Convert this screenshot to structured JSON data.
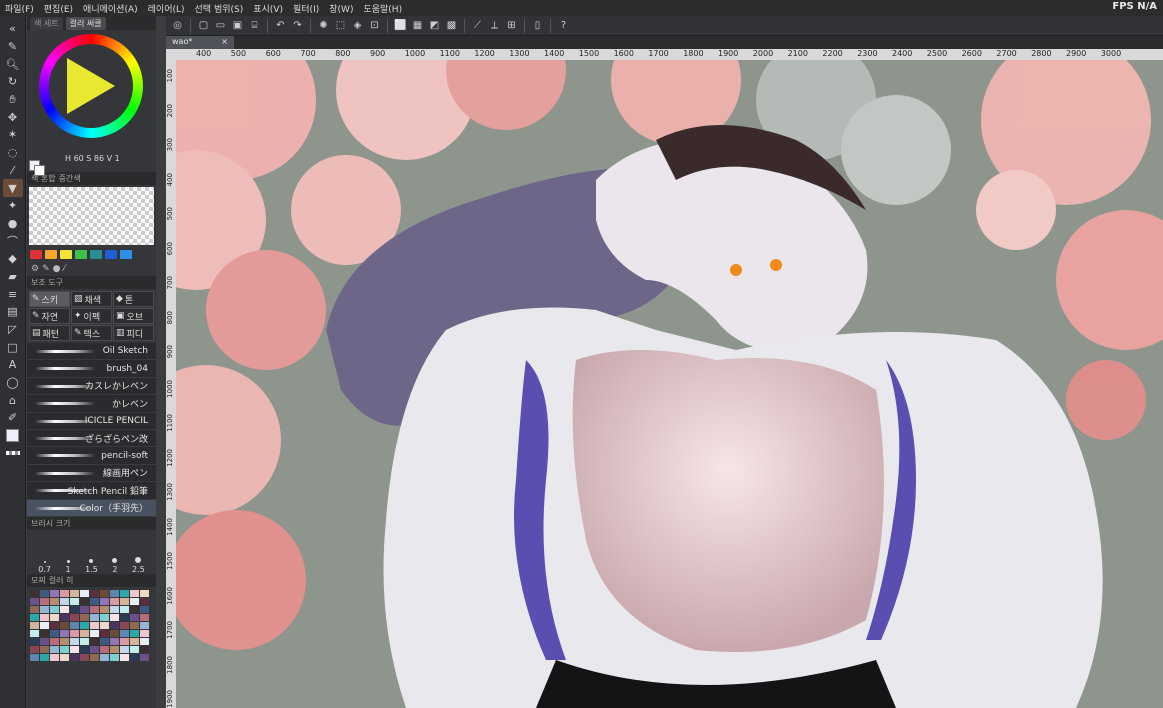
{
  "menu": [
    "파일(F)",
    "편집(E)",
    "애니메이션(A)",
    "레이어(L)",
    "선택 범위(S)",
    "표시(V)",
    "필터(I)",
    "창(W)",
    "도움말(H)"
  ],
  "fps": {
    "label": "FPS",
    "value": "N/A"
  },
  "color_panel": {
    "tab_inactive": "색 세트",
    "tab_active": "컬러 써클",
    "h": "60",
    "s": "86",
    "v": "1"
  },
  "color_mix": {
    "tab1": "색 혼합",
    "tab2": "중간색"
  },
  "swatch_colors": [
    "#e2313a",
    "#f5a52a",
    "#f0e534",
    "#3ec24b",
    "#2a8f92",
    "#1f5fd6",
    "#2e8fe8"
  ],
  "subtool": {
    "header": "보조 도구",
    "items": [
      "스키",
      "채색",
      "톤",
      "자연",
      "이펙",
      "오브",
      "패턴",
      "텍스",
      "피디"
    ]
  },
  "brushes": [
    "Oil Sketch",
    "brush_04",
    "カスレかレベン",
    "かレベン",
    "ICICLE PENCIL",
    "ざらざらペン改",
    "pencil-soft",
    "線画用ペン",
    "Sketch Pencil 鉛筆",
    "Color（手羽先）"
  ],
  "brush_size": {
    "header": "브러시 크기",
    "values": [
      "0.7",
      "1",
      "1.5",
      "2",
      "2.5"
    ]
  },
  "palette_tabs": {
    "tab1": "모찌",
    "tab2": "컬러 히"
  },
  "document": {
    "tab": "wao*"
  },
  "ruler_h": [
    "400",
    "500",
    "600",
    "700",
    "800",
    "900",
    "1000",
    "1100",
    "1200",
    "1300",
    "1400",
    "1500",
    "1600",
    "1700",
    "1800",
    "1900",
    "2000",
    "2100",
    "2200",
    "2300",
    "2400",
    "2500",
    "2600",
    "2700",
    "2800",
    "2900",
    "3000"
  ],
  "ruler_v": [
    "100",
    "200",
    "300",
    "400",
    "500",
    "600",
    "700",
    "800",
    "900",
    "1000",
    "1100",
    "1200",
    "1300",
    "1400",
    "1500",
    "1600",
    "1700",
    "1800",
    "1900"
  ]
}
